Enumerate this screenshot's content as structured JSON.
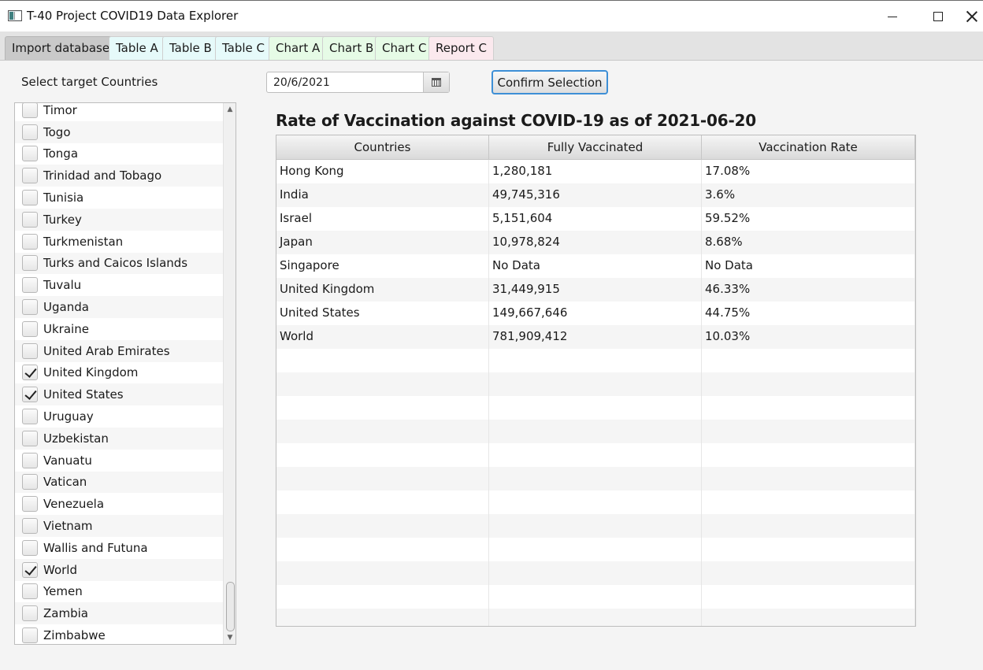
{
  "window": {
    "title": "T-40 Project COVID19 Data Explorer"
  },
  "tabs": [
    {
      "label": "Import database",
      "color": "#c9c9c9"
    },
    {
      "label": "Table A",
      "color": "#e6fafa"
    },
    {
      "label": "Table B",
      "color": "#e6fafa"
    },
    {
      "label": "Table C",
      "color": "#e6fafa"
    },
    {
      "label": "Chart A",
      "color": "#e6fbe6"
    },
    {
      "label": "Chart B",
      "color": "#e6fbe6"
    },
    {
      "label": "Chart C",
      "color": "#e6fbe6"
    },
    {
      "label": "Report C",
      "color": "#fbe9ee"
    }
  ],
  "sidebar": {
    "label": "Select target Countries",
    "countries": [
      {
        "name": "Timor",
        "checked": false
      },
      {
        "name": "Togo",
        "checked": false
      },
      {
        "name": "Tonga",
        "checked": false
      },
      {
        "name": "Trinidad and Tobago",
        "checked": false
      },
      {
        "name": "Tunisia",
        "checked": false
      },
      {
        "name": "Turkey",
        "checked": false
      },
      {
        "name": "Turkmenistan",
        "checked": false
      },
      {
        "name": "Turks and Caicos Islands",
        "checked": false
      },
      {
        "name": "Tuvalu",
        "checked": false
      },
      {
        "name": "Uganda",
        "checked": false
      },
      {
        "name": "Ukraine",
        "checked": false
      },
      {
        "name": "United Arab Emirates",
        "checked": false
      },
      {
        "name": "United Kingdom",
        "checked": true
      },
      {
        "name": "United States",
        "checked": true
      },
      {
        "name": "Uruguay",
        "checked": false
      },
      {
        "name": "Uzbekistan",
        "checked": false
      },
      {
        "name": "Vanuatu",
        "checked": false
      },
      {
        "name": "Vatican",
        "checked": false
      },
      {
        "name": "Venezuela",
        "checked": false
      },
      {
        "name": "Vietnam",
        "checked": false
      },
      {
        "name": "Wallis and Futuna",
        "checked": false
      },
      {
        "name": "World",
        "checked": true
      },
      {
        "name": "Yemen",
        "checked": false
      },
      {
        "name": "Zambia",
        "checked": false
      },
      {
        "name": "Zimbabwe",
        "checked": false
      }
    ]
  },
  "controls": {
    "date_value": "20/6/2021",
    "calendar_icon": "calendar-icon",
    "confirm_label": "Confirm Selection",
    "accent_color": "#3d8fd6"
  },
  "table": {
    "title": "Rate of Vaccination against COVID-19 as of 2021-06-20",
    "columns": [
      "Countries",
      "Fully Vaccinated",
      "Vaccination Rate"
    ],
    "rows": [
      [
        "Hong Kong",
        "1,280,181",
        "17.08%"
      ],
      [
        "India",
        "49,745,316",
        "3.6%"
      ],
      [
        "Israel",
        "5,151,604",
        "59.52%"
      ],
      [
        "Japan",
        "10,978,824",
        "8.68%"
      ],
      [
        "Singapore",
        "No Data",
        "No Data"
      ],
      [
        "United Kingdom",
        "31,449,915",
        "46.33%"
      ],
      [
        "United States",
        "149,667,646",
        "44.75%"
      ],
      [
        "World",
        "781,909,412",
        "10.03%"
      ]
    ]
  }
}
